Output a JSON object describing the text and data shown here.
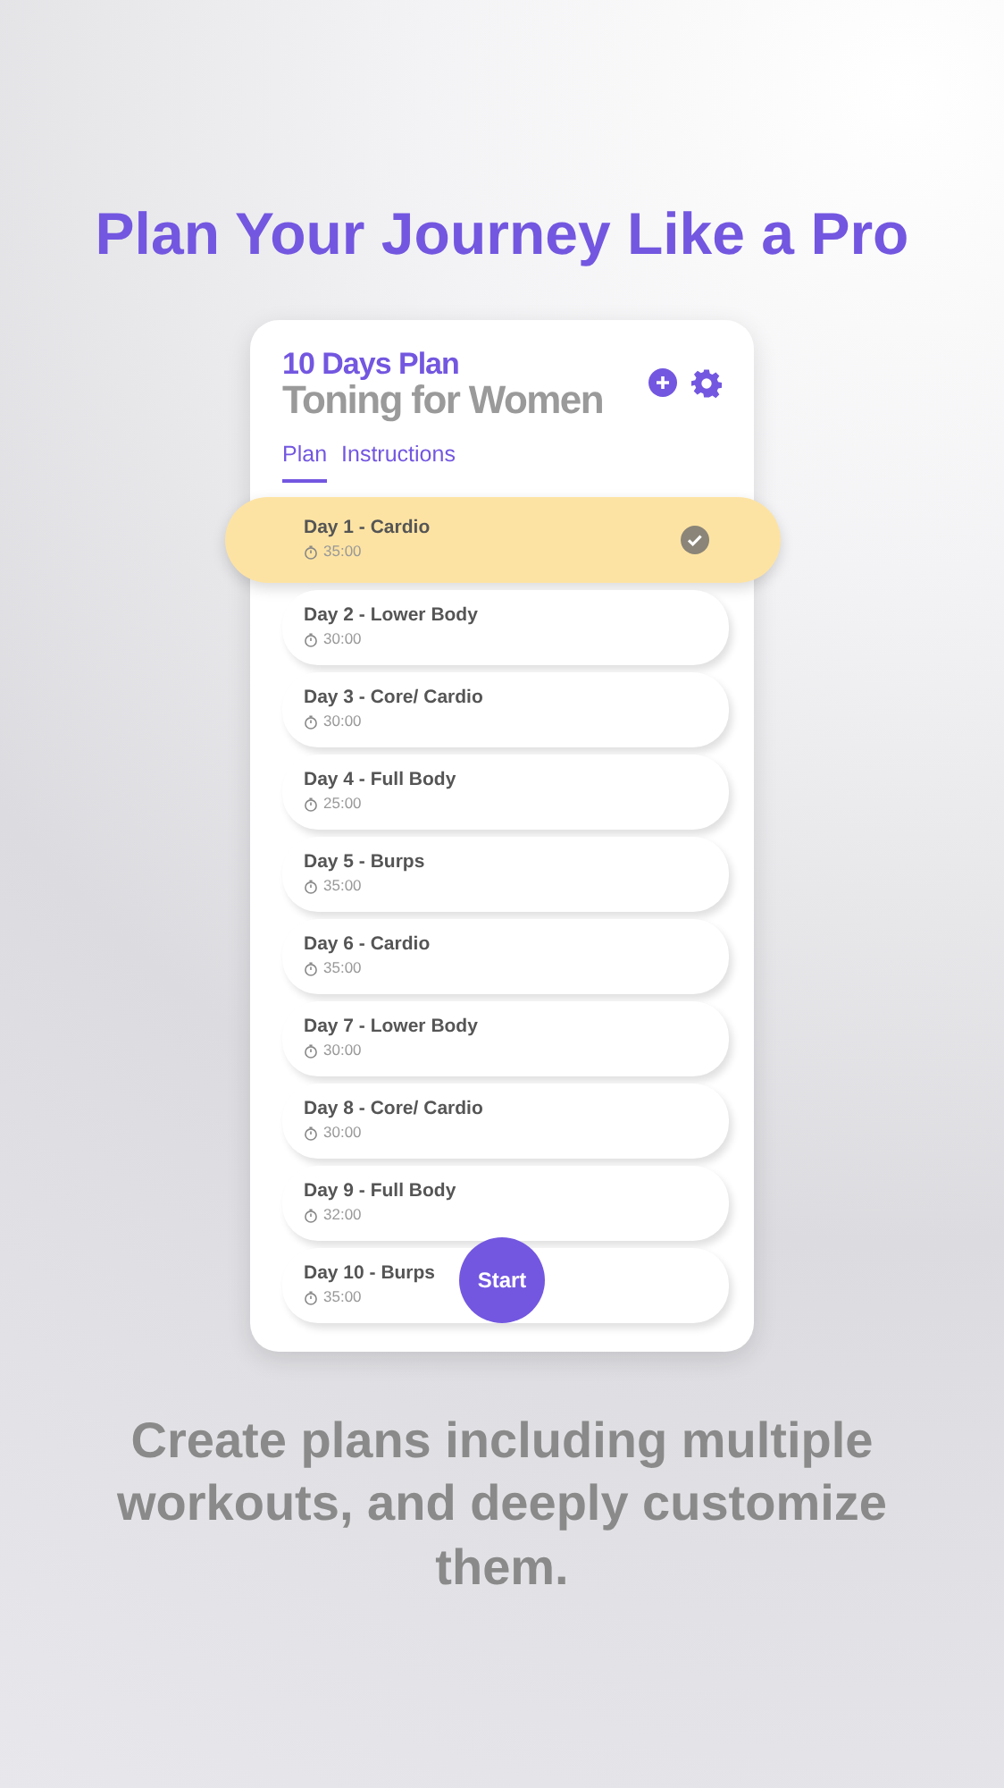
{
  "headline": "Plan Your Journey Like a Pro",
  "card": {
    "subtitle": "10 Days Plan",
    "title": "Toning for Women",
    "tabs": [
      {
        "label": "Plan",
        "selected": true
      },
      {
        "label": "Instructions",
        "selected": false
      }
    ],
    "days": [
      {
        "name": "Day 1 - Cardio",
        "duration": "35:00",
        "selected": true
      },
      {
        "name": "Day 2 - Lower Body",
        "duration": "30:00",
        "selected": false
      },
      {
        "name": "Day 3 - Core/ Cardio",
        "duration": "30:00",
        "selected": false
      },
      {
        "name": "Day 4 - Full Body",
        "duration": "25:00",
        "selected": false
      },
      {
        "name": "Day 5 - Burps",
        "duration": "35:00",
        "selected": false
      },
      {
        "name": "Day 6 - Cardio",
        "duration": "35:00",
        "selected": false
      },
      {
        "name": "Day 7 - Lower Body",
        "duration": "30:00",
        "selected": false
      },
      {
        "name": "Day 8 - Core/ Cardio",
        "duration": "30:00",
        "selected": false
      },
      {
        "name": "Day 9 - Full Body",
        "duration": "32:00",
        "selected": false
      },
      {
        "name": "Day 10 - Burps",
        "duration": "35:00",
        "selected": false
      }
    ],
    "start_button": "Start"
  },
  "caption": "Create plans including multiple workouts, and deeply customize them."
}
